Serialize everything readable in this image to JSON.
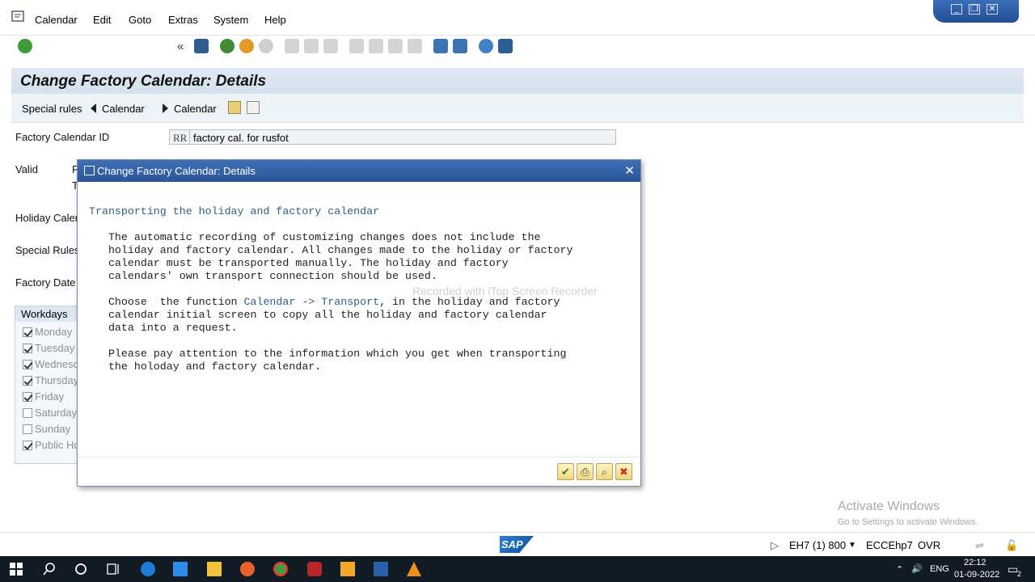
{
  "menu": [
    "Calendar",
    "Edit",
    "Goto",
    "Extras",
    "System",
    "Help"
  ],
  "page_title": "Change Factory Calendar: Details",
  "app_toolbar": {
    "special_rules": "Special rules",
    "prev_calendar": "Calendar",
    "next_calendar": "Calendar"
  },
  "form": {
    "factory_calendar_id_label": "Factory Calendar ID",
    "factory_calendar_id_code": "RR",
    "factory_calendar_id_text": "factory cal. for rusfot",
    "valid_label": "Valid",
    "valid_from_clip": "F",
    "valid_to_clip": "T",
    "holiday_calendar_label": "Holiday Calen",
    "special_rules_label": "Special Rules",
    "factory_date_label": "Factory Date"
  },
  "workdays": {
    "title": "Workdays",
    "days": [
      {
        "label": "Monday",
        "checked": true
      },
      {
        "label": "Tuesday",
        "checked": true
      },
      {
        "label": "Wednesd",
        "checked": true
      },
      {
        "label": "Thursday",
        "checked": true
      },
      {
        "label": "Friday",
        "checked": true
      },
      {
        "label": "Saturday",
        "checked": false
      },
      {
        "label": "Sunday",
        "checked": false
      },
      {
        "label": "Public Ho",
        "checked": true
      }
    ]
  },
  "dialog": {
    "title": "Change Factory Calendar: Details",
    "heading": "Transporting the holiday and factory calendar",
    "para1": "   The automatic recording of customizing changes does not include the\n   holiday and factory calendar. All changes made to the holiday or factory\n   calendar must be transported manually. The holiday and factory\n   calendars' own transport connection should be used.",
    "para2_before": "   Choose  the function ",
    "para2_link": "Calendar -> Transport",
    "para2_after": ", in the holiday and factory\n   calendar initial screen to copy all the holiday and factory calendar\n   data into a request.",
    "para3": "   Please pay attention to the information which you get when transporting\n   the holoday and factory calendar."
  },
  "watermark": "Recorded with iTop Screen Recorder",
  "status": {
    "system": "EH7 (1) 800",
    "server": "ECCEhp7",
    "mode": "OVR",
    "sap_logo": "SAP"
  },
  "activate_windows": {
    "line1": "Activate Windows",
    "line2": "Go to Settings to activate Windows."
  },
  "taskbar": {
    "lang": "ENG",
    "time": "22:12",
    "date": "01-09-2022",
    "notif_count": "2"
  },
  "colors": {
    "dialog_title": "#2b5598",
    "title_bar": "#d2e1ee",
    "accent_link": "#2e5f86"
  }
}
